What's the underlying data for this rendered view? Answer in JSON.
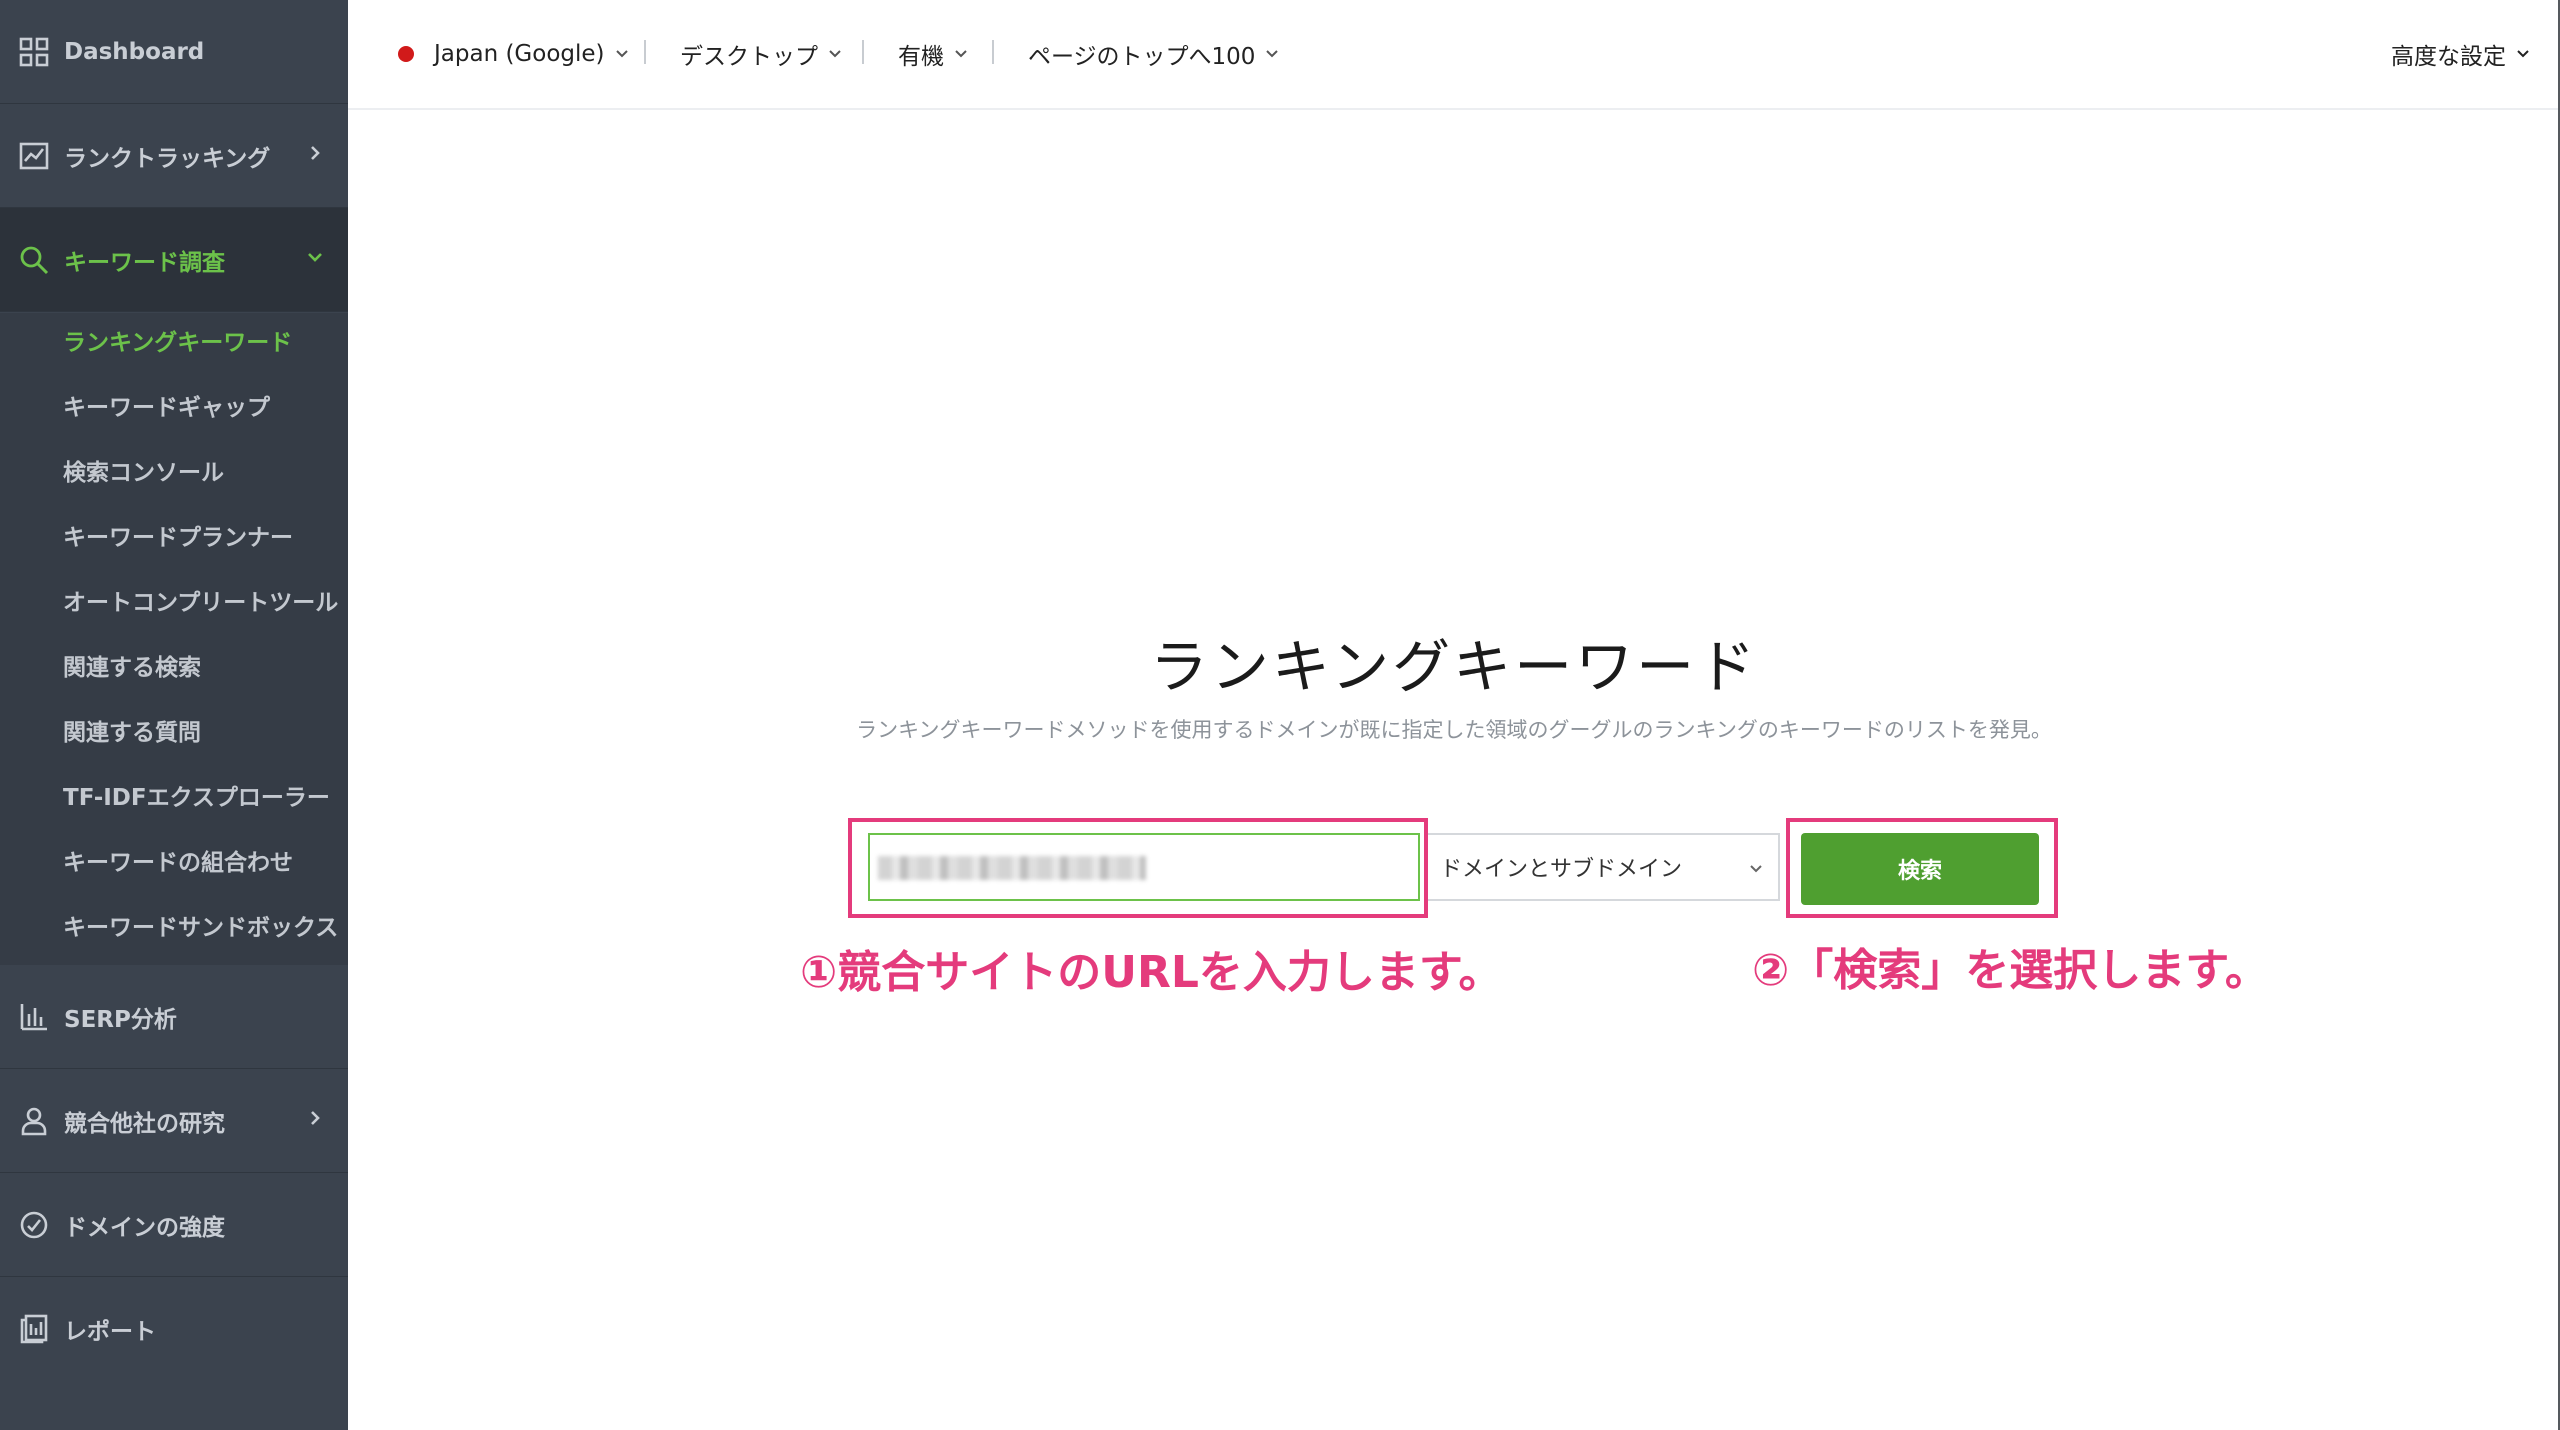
{
  "sidebar": {
    "dashboard": "Dashboard",
    "rank_tracking": "ランクトラッキング",
    "keyword_research": "キーワード調査",
    "submenu": [
      "ランキングキーワード",
      "キーワードギャップ",
      "検索コンソール",
      "キーワードプランナー",
      "オートコンプリートツール",
      "関連する検索",
      "関連する質問",
      "TF-IDFエクスプローラー",
      "キーワードの組合わせ",
      "キーワードサンドボックス"
    ],
    "serp": "SERP分析",
    "competitors": "競合他社の研究",
    "domain_strength": "ドメインの強度",
    "report": "レポート"
  },
  "topbar": {
    "location": "Japan (Google)",
    "device": "デスクトップ",
    "type": "有機",
    "top": "ページのトップへ100",
    "advanced": "高度な設定"
  },
  "main": {
    "title": "ランキングキーワード",
    "description": "ランキングキーワードメソッドを使用するドメインが既に指定した領域のグーグルのランキングのキーワードのリストを発見。",
    "scope_select": "ドメインとサブドメイン",
    "search_button": "検索"
  },
  "annotations": {
    "step1": "①競合サイトのURLを入力します。",
    "step2": "②「検索」を選択します。"
  },
  "colors": {
    "accent_green": "#6cc24a",
    "button_green": "#4f9f30",
    "highlight_pink": "#e43b7c",
    "sidebar_bg": "#3b434e"
  }
}
